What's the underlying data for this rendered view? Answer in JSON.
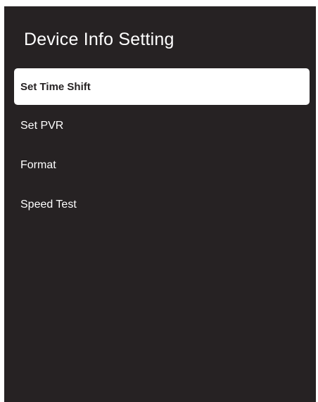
{
  "page": {
    "title": "Device Info Setting"
  },
  "menu": {
    "selected_index": 0,
    "items": [
      {
        "label": "Set Time Shift"
      },
      {
        "label": "Set PVR"
      },
      {
        "label": "Format"
      },
      {
        "label": "Speed Test"
      }
    ]
  },
  "colors": {
    "background": "#262223",
    "text": "#ffffff",
    "selected_background": "#ffffff",
    "selected_text": "#262223"
  }
}
